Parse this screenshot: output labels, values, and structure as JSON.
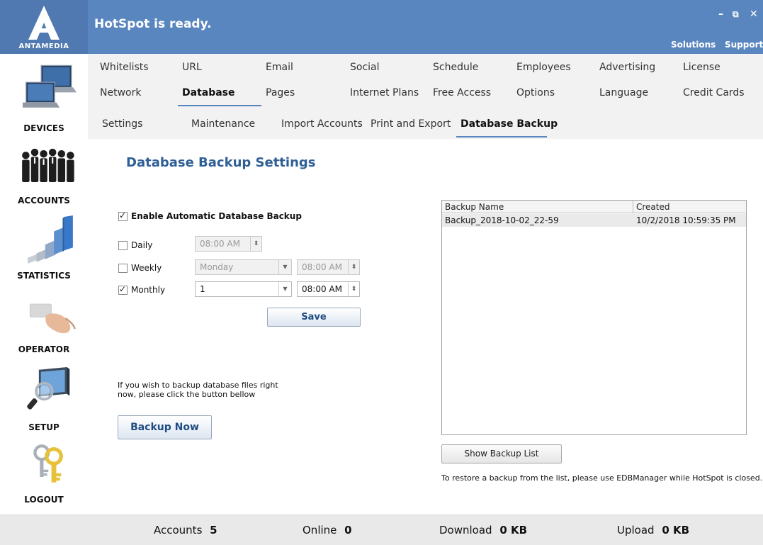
{
  "header": {
    "logo_text": "ANTAMEDIA",
    "status": "HotSpot is ready.",
    "minimize": "–",
    "restore": "⧉",
    "close": "✕",
    "links": [
      "Solutions",
      "Support"
    ]
  },
  "sidebar": {
    "items": [
      {
        "label": "DEVICES",
        "icon": "devices-icon"
      },
      {
        "label": "ACCOUNTS",
        "icon": "accounts-icon"
      },
      {
        "label": "STATISTICS",
        "icon": "statistics-icon"
      },
      {
        "label": "OPERATOR",
        "icon": "operator-icon"
      },
      {
        "label": "SETUP",
        "icon": "setup-icon"
      },
      {
        "label": "LOGOUT",
        "icon": "logout-icon"
      }
    ]
  },
  "tabs": {
    "row1": [
      "Whitelists",
      "URL",
      "Email",
      "Social",
      "Schedule",
      "Employees",
      "Advertising",
      "License"
    ],
    "row2": [
      "Network",
      "Database",
      "Pages",
      "Internet Plans",
      "Free Access",
      "Options",
      "Language",
      "Credit Cards"
    ],
    "active": "Database"
  },
  "subtabs": {
    "items": [
      "Settings",
      "Maintenance",
      "Import Accounts",
      "Print and Export",
      "Database Backup"
    ],
    "active": "Database Backup"
  },
  "main": {
    "title": "Database Backup Settings",
    "enable_backup_label": "Enable Automatic Database Backup",
    "enable_backup_checked": true,
    "daily": {
      "label": "Daily",
      "checked": false,
      "time": "08:00 AM"
    },
    "weekly": {
      "label": "Weekly",
      "checked": false,
      "day": "Monday",
      "time": "08:00 AM"
    },
    "monthly": {
      "label": "Monthly",
      "checked": true,
      "day": "1",
      "time": "08:00 AM"
    },
    "save_label": "Save",
    "backup_hint_line1": "If you wish to backup database files right",
    "backup_hint_line2": "now, please click the button bellow",
    "backup_now_label": "Backup Now"
  },
  "backup_list": {
    "columns": [
      "Backup Name",
      "Created"
    ],
    "rows": [
      {
        "name": "Backup_2018-10-02_22-59",
        "created": "10/2/2018 10:59:35 PM"
      }
    ],
    "show_button": "Show Backup List",
    "restore_note": "To restore a backup from the list, please use EDBManager while HotSpot is closed."
  },
  "footer": {
    "accounts_label": "Accounts",
    "accounts_value": "5",
    "online_label": "Online",
    "online_value": "0",
    "download_label": "Download",
    "download_value": "0 KB",
    "upload_label": "Upload",
    "upload_value": "0 KB"
  },
  "colors": {
    "header": "#5a86bf",
    "title": "#2f5f96",
    "tab_bg": "#f2f2f2"
  }
}
